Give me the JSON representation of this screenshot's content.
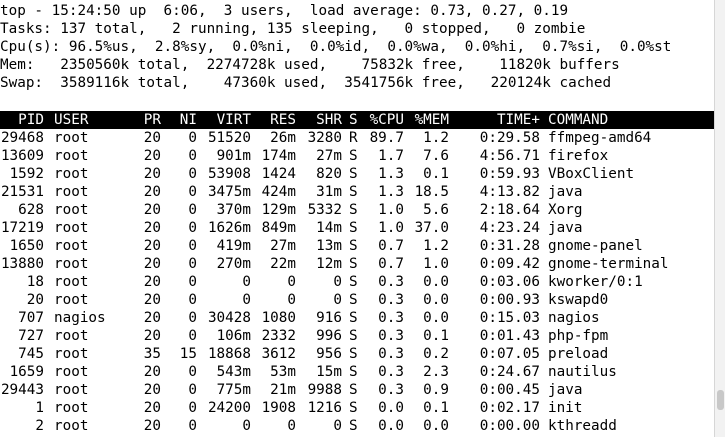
{
  "summary": [
    "top - 15:24:50 up  6:06,  3 users,  load average: 0.73, 0.27, 0.19",
    "Tasks: 137 total,   2 running, 135 sleeping,   0 stopped,   0 zombie",
    "Cpu(s): 96.5%us,  2.8%sy,  0.0%ni,  0.0%id,  0.0%wa,  0.0%hi,  0.7%si,  0.0%st",
    "Mem:   2350560k total,  2274728k used,    75832k free,    11820k buffers",
    "Swap:  3589116k total,    47360k used,  3541756k free,   220124k cached"
  ],
  "headers": [
    "PID",
    "USER",
    "PR",
    "NI",
    "VIRT",
    "RES",
    "SHR",
    "S",
    "%CPU",
    "%MEM",
    "TIME+",
    "COMMAND"
  ],
  "processes": [
    [
      "29468",
      "root",
      "20",
      "0",
      "51520",
      "26m",
      "3280",
      "R",
      "89.7",
      "1.2",
      "0:29.58",
      "ffmpeg-amd64"
    ],
    [
      "13609",
      "root",
      "20",
      "0",
      "901m",
      "174m",
      "27m",
      "S",
      "1.7",
      "7.6",
      "4:56.71",
      "firefox"
    ],
    [
      "1592",
      "root",
      "20",
      "0",
      "53908",
      "1424",
      "820",
      "S",
      "1.3",
      "0.1",
      "0:59.93",
      "VBoxClient"
    ],
    [
      "21531",
      "root",
      "20",
      "0",
      "3475m",
      "424m",
      "31m",
      "S",
      "1.3",
      "18.5",
      "4:13.82",
      "java"
    ],
    [
      "628",
      "root",
      "20",
      "0",
      "370m",
      "129m",
      "5332",
      "S",
      "1.0",
      "5.6",
      "2:18.64",
      "Xorg"
    ],
    [
      "17219",
      "root",
      "20",
      "0",
      "1626m",
      "849m",
      "14m",
      "S",
      "1.0",
      "37.0",
      "4:23.24",
      "java"
    ],
    [
      "1650",
      "root",
      "20",
      "0",
      "419m",
      "27m",
      "13m",
      "S",
      "0.7",
      "1.2",
      "0:31.28",
      "gnome-panel"
    ],
    [
      "13880",
      "root",
      "20",
      "0",
      "270m",
      "22m",
      "12m",
      "S",
      "0.7",
      "1.0",
      "0:09.42",
      "gnome-terminal"
    ],
    [
      "18",
      "root",
      "20",
      "0",
      "0",
      "0",
      "0",
      "S",
      "0.3",
      "0.0",
      "0:03.06",
      "kworker/0:1"
    ],
    [
      "20",
      "root",
      "20",
      "0",
      "0",
      "0",
      "0",
      "S",
      "0.3",
      "0.0",
      "0:00.93",
      "kswapd0"
    ],
    [
      "707",
      "nagios",
      "20",
      "0",
      "30428",
      "1080",
      "916",
      "S",
      "0.3",
      "0.0",
      "0:15.03",
      "nagios"
    ],
    [
      "727",
      "root",
      "20",
      "0",
      "106m",
      "2332",
      "996",
      "S",
      "0.3",
      "0.1",
      "0:01.43",
      "php-fpm"
    ],
    [
      "745",
      "root",
      "35",
      "15",
      "18868",
      "3612",
      "956",
      "S",
      "0.3",
      "0.2",
      "0:07.05",
      "preload"
    ],
    [
      "1659",
      "root",
      "20",
      "0",
      "543m",
      "53m",
      "15m",
      "S",
      "0.3",
      "2.3",
      "0:24.67",
      "nautilus"
    ],
    [
      "29443",
      "root",
      "20",
      "0",
      "775m",
      "21m",
      "9988",
      "S",
      "0.3",
      "0.9",
      "0:00.45",
      "java"
    ],
    [
      "1",
      "root",
      "20",
      "0",
      "24200",
      "1908",
      "1216",
      "S",
      "0.0",
      "0.1",
      "0:02.17",
      "init"
    ],
    [
      "2",
      "root",
      "20",
      "0",
      "0",
      "0",
      "0",
      "S",
      "0.0",
      "0.0",
      "0:00.00",
      "kthreadd"
    ]
  ],
  "colors": {
    "background": "#ffffff",
    "text": "#000000",
    "header_bg": "#000000",
    "header_text": "#ffffff"
  }
}
